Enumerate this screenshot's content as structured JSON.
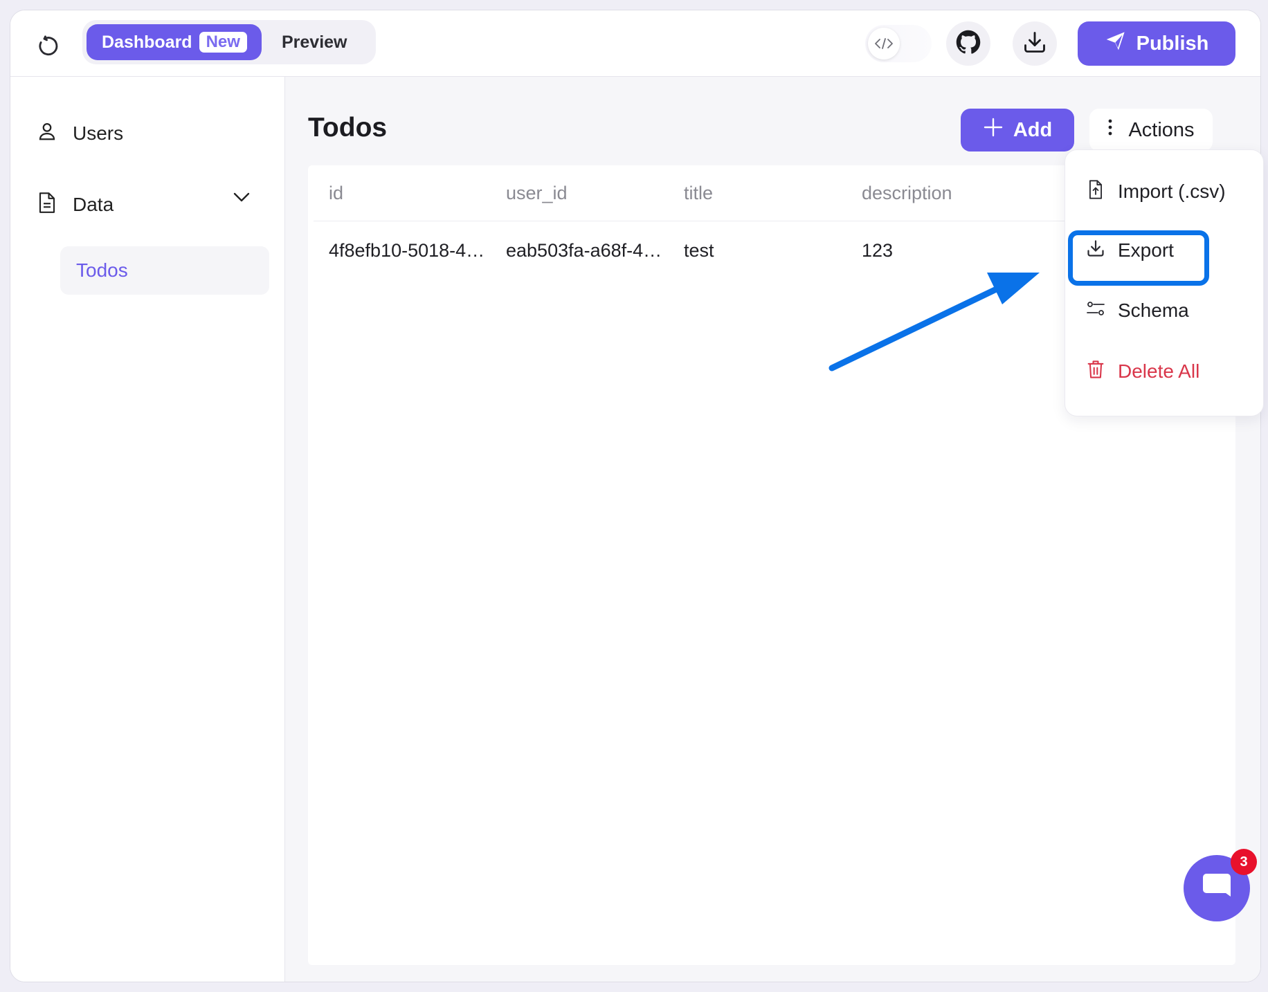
{
  "header": {
    "tabs": {
      "dashboard_label": "Dashboard",
      "new_badge": "New",
      "preview_label": "Preview"
    },
    "publish_label": "Publish",
    "icons": [
      "refresh-icon",
      "code-icon",
      "github-icon",
      "download-icon",
      "send-icon"
    ]
  },
  "sidebar": {
    "items": [
      {
        "label": "Users",
        "icon": "user-icon"
      },
      {
        "label": "Data",
        "icon": "document-icon"
      }
    ],
    "sub_items": [
      {
        "label": "Todos"
      }
    ]
  },
  "main": {
    "title": "Todos",
    "add_label": "Add",
    "actions_label": "Actions"
  },
  "table": {
    "columns": [
      "id",
      "user_id",
      "title",
      "description"
    ],
    "rows": [
      [
        "4f8efb10-5018-4…",
        "eab503fa-a68f-4…",
        "test",
        "123"
      ]
    ]
  },
  "actions_menu": {
    "items": [
      {
        "label": "Import (.csv)",
        "icon": "file-upload-icon"
      },
      {
        "label": "Export",
        "icon": "download-icon",
        "highlighted": true
      },
      {
        "label": "Schema",
        "icon": "sliders-icon"
      },
      {
        "label": "Delete All",
        "icon": "trash-icon",
        "color": "#d9364a"
      }
    ]
  },
  "chat": {
    "badge_count": "3"
  },
  "colors": {
    "accent": "#6b5bea",
    "highlight_blue": "#0a72e8",
    "danger": "#d9364a",
    "badge_red": "#e8112c"
  }
}
